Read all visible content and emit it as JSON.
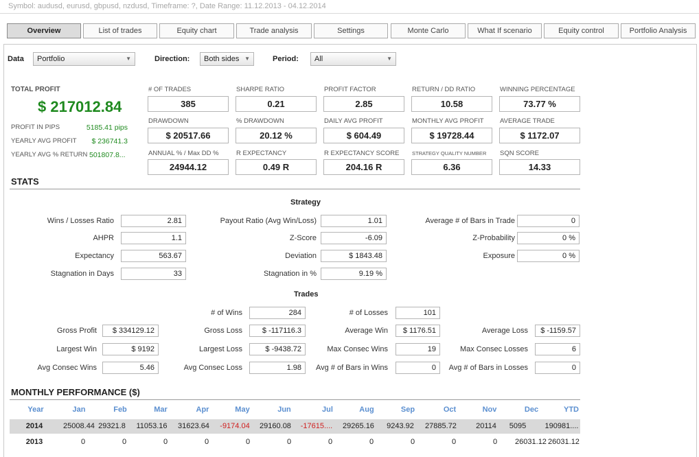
{
  "top_info": "Symbol: audusd, eurusd, gbpusd, nzdusd, Timeframe: ?, Date Range: 11.12.2013 - 04.12.2014",
  "tabs": [
    {
      "label": "Overview",
      "active": true
    },
    {
      "label": "List of trades"
    },
    {
      "label": "Equity chart"
    },
    {
      "label": "Trade analysis"
    },
    {
      "label": "Settings"
    },
    {
      "label": "Monte Carlo"
    },
    {
      "label": "What If scenario"
    },
    {
      "label": "Equity control"
    },
    {
      "label": "Portfolio Analysis"
    }
  ],
  "filters": {
    "data_label": "Data",
    "data_value": "Portfolio",
    "direction_label": "Direction:",
    "direction_value": "Both sides",
    "period_label": "Period:",
    "period_value": "All"
  },
  "summary": {
    "total_profit_label": "TOTAL PROFIT",
    "total_profit_value": "$ 217012.84",
    "side": [
      {
        "label": "PROFIT IN PIPS",
        "value": "5185.41 pips"
      },
      {
        "label": "YEARLY AVG PROFIT",
        "value": "$ 236741.3"
      },
      {
        "label": "YEARLY AVG % RETURN",
        "value": "501807.8..."
      }
    ]
  },
  "metrics": [
    {
      "label": "# OF TRADES",
      "value": "385"
    },
    {
      "label": "SHARPE RATIO",
      "value": "0.21"
    },
    {
      "label": "PROFIT FACTOR",
      "value": "2.85"
    },
    {
      "label": "RETURN / DD RATIO",
      "value": "10.58"
    },
    {
      "label": "WINNING PERCENTAGE",
      "value": "73.77 %"
    },
    {
      "label": "DRAWDOWN",
      "value": "$ 20517.66"
    },
    {
      "label": "% DRAWDOWN",
      "value": "20.12 %"
    },
    {
      "label": "DAILY AVG PROFIT",
      "value": "$ 604.49"
    },
    {
      "label": "MONTHLY AVG PROFIT",
      "value": "$ 19728.44"
    },
    {
      "label": "AVERAGE TRADE",
      "value": "$ 1172.07"
    },
    {
      "label": "ANNUAL % / Max DD %",
      "value": "24944.12"
    },
    {
      "label": "R EXPECTANCY",
      "value": "0.49 R"
    },
    {
      "label": "R EXPECTANCY SCORE",
      "value": "204.16 R"
    },
    {
      "label": "STRATEGY QUALITY NUMBER",
      "value": "6.36"
    },
    {
      "label": "SQN SCORE",
      "value": "14.33"
    }
  ],
  "stats": {
    "title": "STATS",
    "strategy_title": "Strategy",
    "strategy": [
      {
        "label": "Wins / Losses Ratio",
        "value": "2.81"
      },
      {
        "label": "Payout Ratio (Avg Win/Loss)",
        "value": "1.01"
      },
      {
        "label": "Average # of Bars in Trade",
        "value": "0"
      },
      {
        "label": "AHPR",
        "value": "1.1"
      },
      {
        "label": "Z-Score",
        "value": "-6.09"
      },
      {
        "label": "Z-Probability",
        "value": "0 %"
      },
      {
        "label": "Expectancy",
        "value": "563.67"
      },
      {
        "label": "Deviation",
        "value": "$ 1843.48"
      },
      {
        "label": "Exposure",
        "value": "0 %"
      },
      {
        "label": "Stagnation in Days",
        "value": "33"
      },
      {
        "label": "Stagnation in %",
        "value": "9.19 %"
      }
    ],
    "trades_title": "Trades",
    "trades": [
      {
        "label": "# of Wins",
        "value": "284"
      },
      {
        "label": "# of Losses",
        "value": "101"
      },
      {
        "label": "Gross Profit",
        "value": "$ 334129.12"
      },
      {
        "label": "Gross Loss",
        "value": "$ -117116.3"
      },
      {
        "label": "Average Win",
        "value": "$ 1176.51"
      },
      {
        "label": "Average Loss",
        "value": "$ -1159.57"
      },
      {
        "label": "Largest Win",
        "value": "$ 9192"
      },
      {
        "label": "Largest Loss",
        "value": "$ -9438.72"
      },
      {
        "label": "Max Consec Wins",
        "value": "19"
      },
      {
        "label": "Max Consec Losses",
        "value": "6"
      },
      {
        "label": "Avg Consec Wins",
        "value": "5.46"
      },
      {
        "label": "Avg Consec Loss",
        "value": "1.98"
      },
      {
        "label": "Avg # of Bars in Wins",
        "value": "0"
      },
      {
        "label": "Avg # of Bars in Losses",
        "value": "0"
      }
    ]
  },
  "monthly": {
    "title": "MONTHLY PERFORMANCE ($)",
    "headers": [
      "Year",
      "Jan",
      "Feb",
      "Mar",
      "Apr",
      "May",
      "Jun",
      "Jul",
      "Aug",
      "Sep",
      "Oct",
      "Nov",
      "Dec",
      "YTD"
    ],
    "rows": [
      {
        "year": "2014",
        "cells": [
          "25008.44",
          "29321.8",
          "11053.16",
          "31623.64",
          "-9174.04",
          "29160.08",
          "-17615....",
          "29265.16",
          "9243.92",
          "27885.72",
          "20114",
          "5095",
          "190981...."
        ]
      },
      {
        "year": "2013",
        "cells": [
          "0",
          "0",
          "0",
          "0",
          "0",
          "0",
          "0",
          "0",
          "0",
          "0",
          "0",
          "26031.12",
          "26031.12"
        ]
      }
    ],
    "negative_color": "#d02020",
    "header_color": "#5b8fd0"
  },
  "colors": {
    "profit_green": "#1f8a1f"
  }
}
